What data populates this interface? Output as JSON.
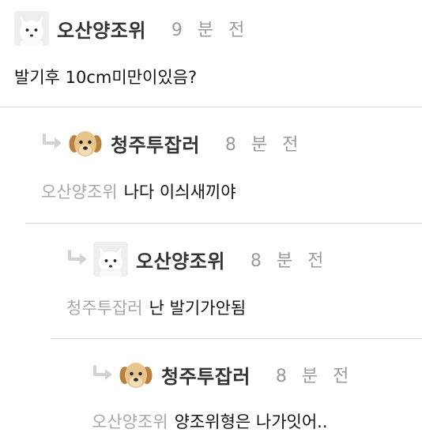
{
  "comments": [
    {
      "author": "오산양조위",
      "time": "9 분 전",
      "text": "발기후 10cm미만이있음?",
      "avatar": "arctic-fox"
    },
    {
      "author": "청주투잡러",
      "time": "8 분 전",
      "mention": "오산양조위",
      "text": "나다 이싀새끼야",
      "avatar": "puppy"
    },
    {
      "author": "오산양조위",
      "time": "8 분 전",
      "mention": "청주투잡러",
      "text": "난 발기가안됨",
      "avatar": "arctic-fox"
    },
    {
      "author": "청주투잡러",
      "time": "8 분 전",
      "mention": "오산양조위",
      "text": "양조위형은 나가잇어..",
      "avatar": "puppy"
    }
  ],
  "icons": {
    "reply": "reply-arrow-icon"
  },
  "colors": {
    "mention": "#a8a8a8",
    "time": "#9a9a9a",
    "divider": "#dcdcdc",
    "reply_arrow": "#d2d2d2"
  }
}
